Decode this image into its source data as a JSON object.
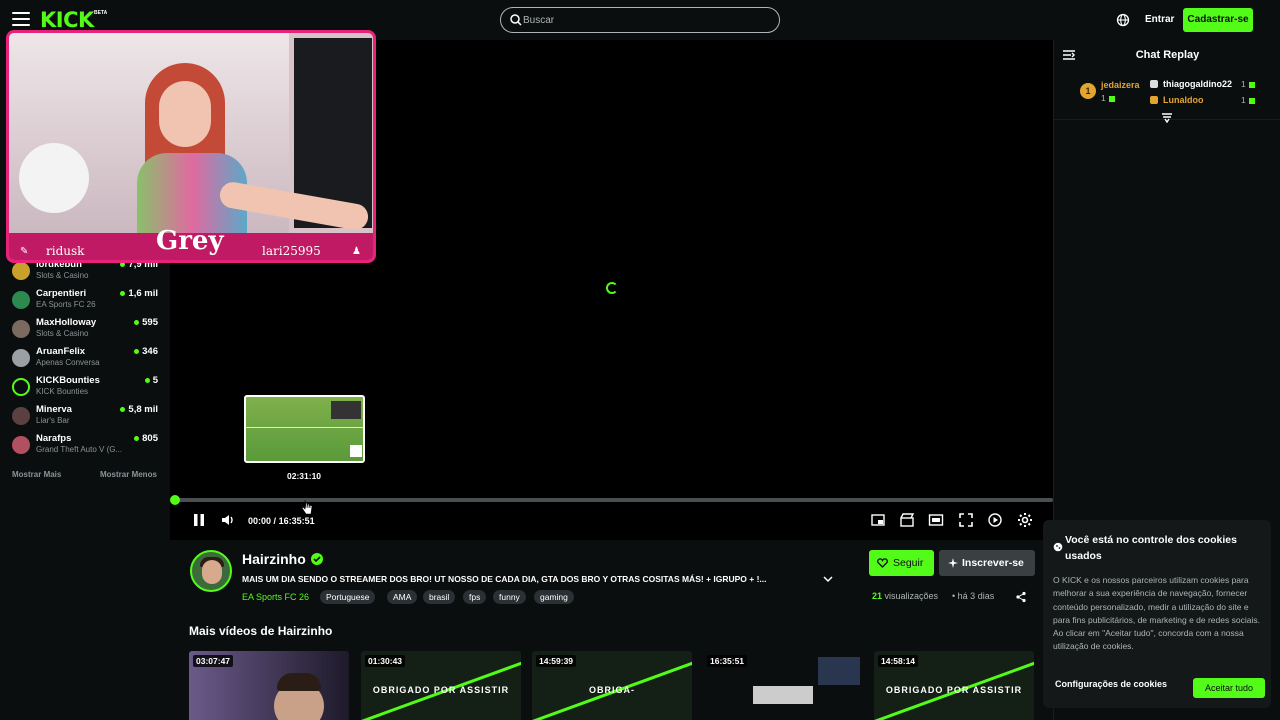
{
  "header": {
    "logo": "KICK",
    "beta": "BETA",
    "search_placeholder": "Buscar",
    "login_label": "Entrar",
    "signup_label": "Cadastrar-se"
  },
  "webcam_overlay": {
    "left_name": "ridusk",
    "center_name": "Grey",
    "right_name": "lari25995"
  },
  "sidebar": {
    "channels": [
      {
        "name": "lordkebun",
        "category": "Slots & Casino",
        "viewers": "7,9 mil"
      },
      {
        "name": "Carpentieri",
        "category": "EA Sports FC 26",
        "viewers": "1,6 mil"
      },
      {
        "name": "MaxHolloway",
        "category": "Slots & Casino",
        "viewers": "595"
      },
      {
        "name": "AruanFelix",
        "category": "Apenas Conversa",
        "viewers": "346"
      },
      {
        "name": "KICKBounties",
        "category": "KICK Bounties",
        "viewers": "5"
      },
      {
        "name": "Minerva",
        "category": "Liar's Bar",
        "viewers": "5,8 mil"
      },
      {
        "name": "Narafps",
        "category": "Grand Theft Auto V (G...",
        "viewers": "805"
      }
    ],
    "show_more": "Mostrar Mais",
    "show_less": "Mostrar Menos"
  },
  "player": {
    "preview_time": "02:31:10",
    "current_time": "00:00",
    "separator": "/",
    "duration": "16:35:51",
    "progress_fraction": 0.0
  },
  "chat": {
    "title": "Chat Replay",
    "gifters": [
      {
        "rank": "1",
        "name": "jedaizera",
        "count": "1",
        "color": "#e2a530"
      },
      {
        "name": "thiagogaldino22",
        "count": "1",
        "color": "#ffffff"
      },
      {
        "name": "Lunaldoo",
        "count": "1",
        "color": "#e2a530"
      }
    ]
  },
  "channel": {
    "name": "Hairzinho",
    "title": "MAIS UM DIA SENDO O STREAMER DOS BRO! UT NOSSO DE CADA DIA, GTA DOS BRO Y OTRAS COSITAS MÁS! + IGRUPO + !...",
    "category": "EA Sports FC 26",
    "tags": [
      "Portuguese",
      "AMA",
      "brasil",
      "fps",
      "funny",
      "gaming"
    ],
    "follow_label": "Seguir",
    "subscribe_label": "Inscrever-se",
    "views_count": "21",
    "views_label": "visualizações",
    "dot": "•",
    "ago": "há 3 dias"
  },
  "more_videos": {
    "title": "Mais vídeos de Hairzinho",
    "videos": [
      {
        "duration": "03:07:47",
        "overlay": ""
      },
      {
        "duration": "01:30:43",
        "overlay": "OBRIGADO POR ASSISTIR"
      },
      {
        "duration": "14:59:39",
        "overlay": "OBRIGA-"
      },
      {
        "duration": "16:35:51",
        "overlay": ""
      },
      {
        "duration": "14:58:14",
        "overlay": "OBRIGADO POR ASSISTIR"
      }
    ]
  },
  "cookie_banner": {
    "title": "Você está no controle dos cookies usados",
    "text": "O KICK e os nossos parceiros utilizam cookies para melhorar a sua experiência de navegação, fornecer conteúdo personalizado, medir a utilização do site e para fins publicitários, de marketing e de redes sociais. Ao clicar em \"Aceitar tudo\", concorda com a nossa utilização de cookies.",
    "config_label": "Configurações de cookies",
    "accept_label": "Aceitar tudo"
  },
  "colors": {
    "accent": "#53fc18",
    "background": "#0b0e0f",
    "overlay_pink": "#e8217a"
  }
}
